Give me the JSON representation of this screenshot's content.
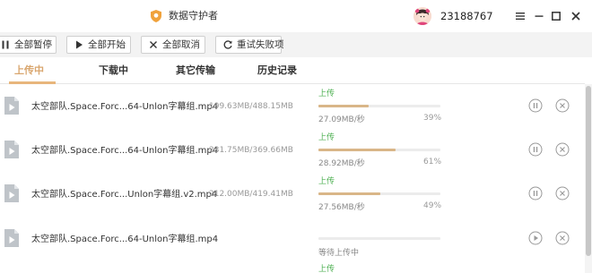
{
  "window": {
    "title": "数据守护者",
    "user_id": "23188767",
    "accent_color": "#f0a23c",
    "icons": [
      "shield-logo-icon",
      "avatar",
      "hamburger-menu-icon",
      "minimize-icon",
      "maximize-icon",
      "close-icon"
    ]
  },
  "toolbar": {
    "pause_all": "全部暂停",
    "start_all": "全部开始",
    "cancel_all": "全部取消",
    "retry_failed": "重试失败项"
  },
  "tabs": [
    {
      "label": "上传中",
      "active": true
    },
    {
      "label": "下载中",
      "active": false
    },
    {
      "label": "其它传输",
      "active": false
    },
    {
      "label": "历史记录",
      "active": false
    }
  ],
  "transfers": [
    {
      "name": "太空部队.Space.Forc...64-Unlon字幕组.mp4",
      "size": "199.63MB/488.15MB",
      "status": "上传",
      "progress": 0.41,
      "speed": "27.09MB/秒",
      "percent": "39%",
      "action": "pause"
    },
    {
      "name": "太空部队.Space.Forc...64-Unlon字幕组.mp4",
      "size": "231.75MB/369.66MB",
      "status": "上传",
      "progress": 0.63,
      "speed": "28.92MB/秒",
      "percent": "61%",
      "action": "pause"
    },
    {
      "name": "太空部队.Space.Forc...Unlon字幕组.v2.mp4",
      "size": "212.00MB/419.41MB",
      "status": "上传",
      "progress": 0.51,
      "speed": "27.56MB/秒",
      "percent": "49%",
      "action": "pause"
    },
    {
      "name": "太空部队.Space.Forc...64-Unlon字幕组.mp4",
      "size": "",
      "status": "等待上传中",
      "progress": 0,
      "speed": "",
      "percent": "",
      "action": "play"
    },
    {
      "name": "",
      "size": "",
      "status": "上传",
      "progress": 0,
      "speed": "",
      "percent": "",
      "action": "pause"
    }
  ],
  "colors": {
    "progress_fill": "#d9b688",
    "status_green": "#4caf50",
    "tab_active": "#d9a66e"
  }
}
